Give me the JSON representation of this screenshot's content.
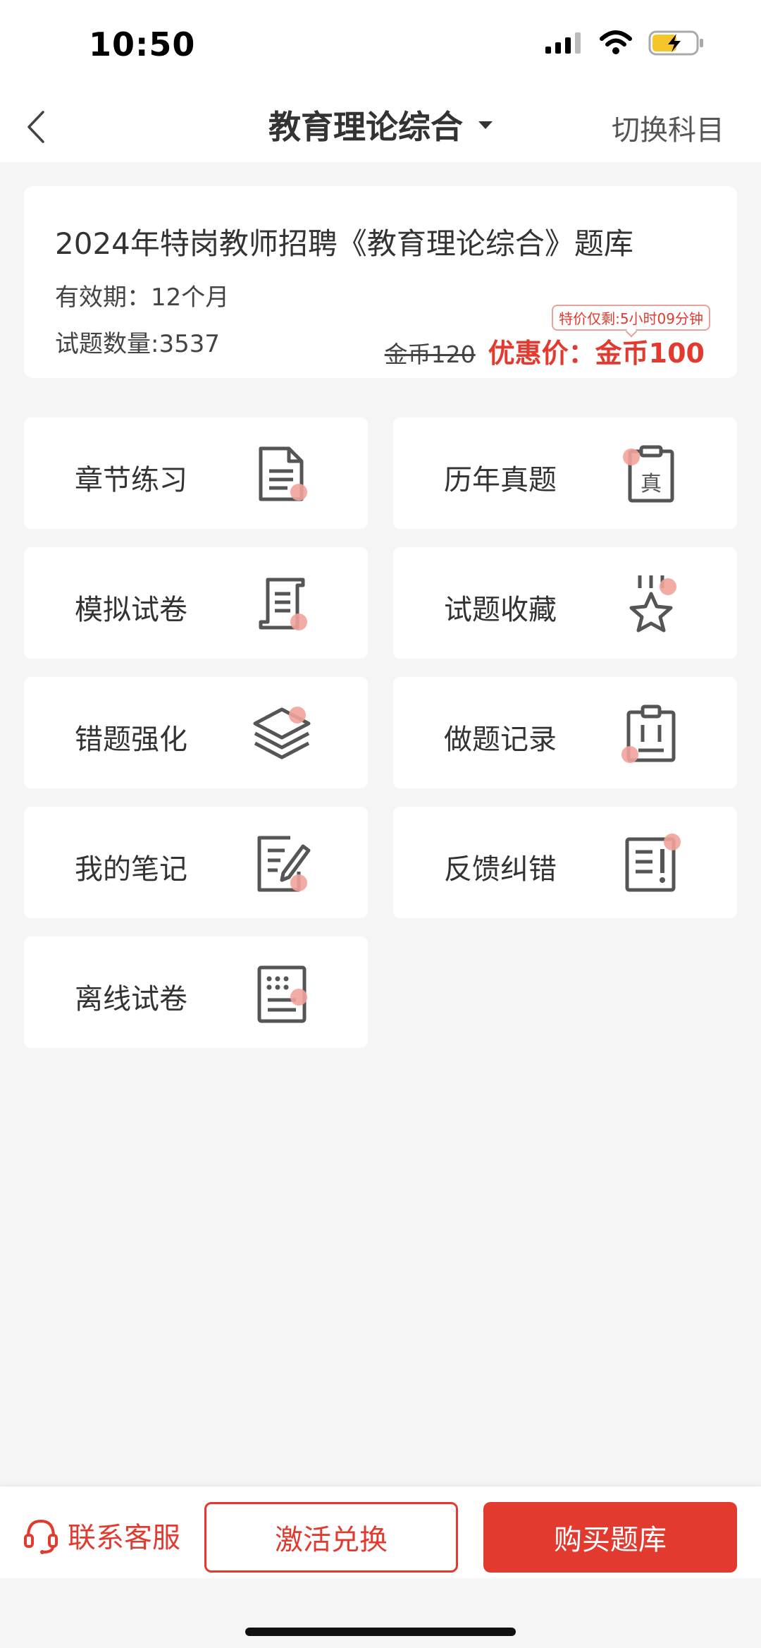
{
  "status_bar": {
    "time": "10:50"
  },
  "nav": {
    "title": "教育理论综合",
    "switch_label": "切换科目"
  },
  "info": {
    "title": "2024年特岗教师招聘《教育理论综合》题库",
    "validity": "有效期：12个月",
    "question_count": "试题数量:3537",
    "old_price": "金币120",
    "new_price": "优惠价：金币100",
    "promo": "特价仅剩:5小时09分钟"
  },
  "menu": [
    {
      "label": "章节练习",
      "icon": "document-icon"
    },
    {
      "label": "历年真题",
      "icon": "clipboard-exam-icon"
    },
    {
      "label": "模拟试卷",
      "icon": "scroll-paper-icon"
    },
    {
      "label": "试题收藏",
      "icon": "star-icon"
    },
    {
      "label": "错题强化",
      "icon": "layers-icon"
    },
    {
      "label": "做题记录",
      "icon": "clipboard-record-icon"
    },
    {
      "label": "我的笔记",
      "icon": "note-edit-icon"
    },
    {
      "label": "反馈纠错",
      "icon": "feedback-icon"
    },
    {
      "label": "离线试卷",
      "icon": "offline-paper-icon"
    }
  ],
  "bottom": {
    "contact": "联系客服",
    "activate": "激活兑换",
    "buy": "购买题库"
  },
  "colors": {
    "accent": "#e23a2e",
    "icon_dot": "#f2a29b"
  }
}
